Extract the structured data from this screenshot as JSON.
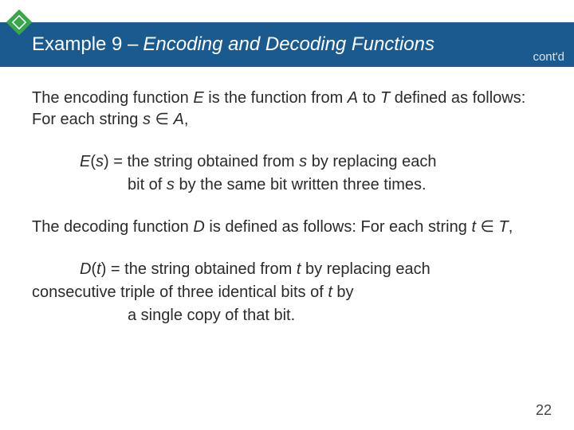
{
  "header": {
    "example_label": "Example 9 –",
    "topic": "Encoding and Decoding Functions",
    "contd": "cont'd"
  },
  "body": {
    "p1_a": "The encoding function ",
    "p1_E": "E",
    "p1_b": " is the function from ",
    "p1_A": "A",
    "p1_c": " to ",
    "p1_T": "T",
    "p1_d": " defined as follows: For each string ",
    "p1_s": "s",
    "p1_e": " ∈ ",
    "p1_A2": "A",
    "p1_f": ",",
    "eq1_a": "E",
    "eq1_b": "(",
    "eq1_s": "s",
    "eq1_c": ") = the string obtained from ",
    "eq1_s2": "s",
    "eq1_d": " by replacing each",
    "eq1_line2a": "bit of ",
    "eq1_line2s": "s",
    "eq1_line2b": " by the same bit written three times.",
    "p2_a": "The decoding function ",
    "p2_D": "D",
    "p2_b": " is defined as follows: For each string ",
    "p2_t": "t",
    "p2_c": " ∈ ",
    "p2_T": "T",
    "p2_d": ",",
    "eq2_a": "D",
    "eq2_b": "(",
    "eq2_t": "t",
    "eq2_c": ") = the string obtained from ",
    "eq2_t2": "t",
    "eq2_d": " by replacing each",
    "eq2_line2a": "consecutive triple of three identical bits of ",
    "eq2_line2t": "t",
    "eq2_line2b": " by",
    "eq2_line3": "a single copy of that bit."
  },
  "page_number": "22",
  "colors": {
    "title_bg": "#1b5a8e",
    "diamond_green": "#3aa54a"
  }
}
